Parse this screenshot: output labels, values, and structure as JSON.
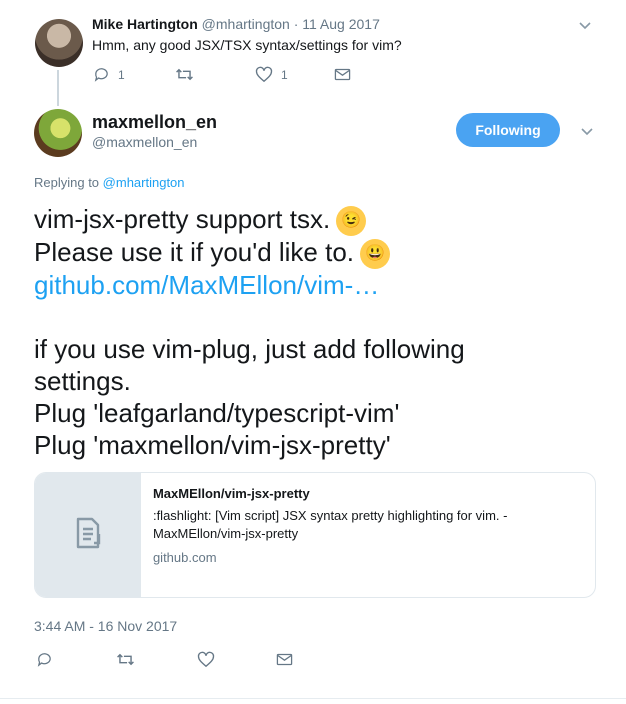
{
  "parent_tweet": {
    "display_name": "Mike Hartington",
    "handle_and_date": "@mhartington · 11 Aug 2017",
    "text": "Hmm, any good JSX/TSX syntax/settings for vim?",
    "reply_count": "1",
    "like_count": "1"
  },
  "main_tweet": {
    "display_name": "maxmellon_en",
    "handle": "@maxmellon_en",
    "follow_label": "Following",
    "replying_prefix": "Replying to",
    "replying_to": "@mhartington",
    "lines": [
      "vim-jsx-pretty support tsx.",
      "Please use it if you'd like to.",
      "github.com/MaxMEllon/vim-…",
      "",
      "if you use vim-plug, just add following",
      "settings.",
      "Plug 'leafgarland/typescript-vim'",
      "Plug 'maxmellon/vim-jsx-pretty'"
    ],
    "card": {
      "title": "MaxMEllon/vim-jsx-pretty",
      "description": ":flashlight: [Vim script] JSX syntax pretty highlighting for vim. - MaxMEllon/vim-jsx-pretty",
      "domain": "github.com"
    },
    "timestamp": "3:44 AM - 16 Nov 2017"
  },
  "colors": {
    "accent": "#1da1f2",
    "follow_button": "#4aa3f2",
    "muted_text": "#657786"
  },
  "icons": [
    "reply-icon",
    "retweet-icon",
    "like-icon",
    "message-icon",
    "chevron-down-icon",
    "document-icon",
    "wink-emoji",
    "smile-emoji"
  ]
}
